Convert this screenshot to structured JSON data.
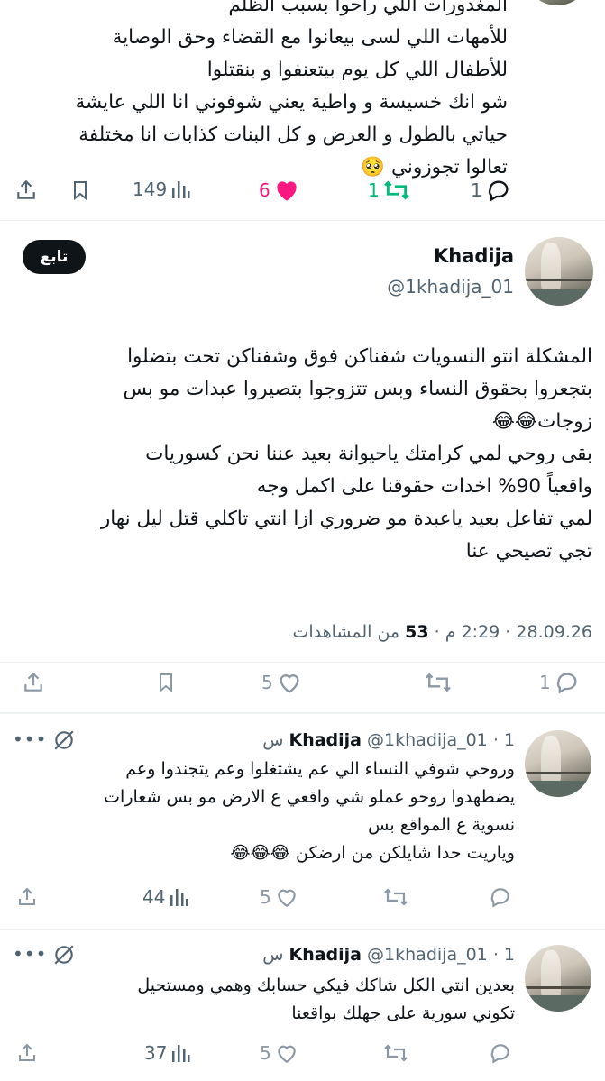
{
  "top_tweet": {
    "lines": [
      "المغدورات اللي راحوا بسبب الظلم",
      "للأمهات اللي لسى بيعانوا مع القضاء وحق الوصاية",
      "للأطفال اللي كل يوم بيتعنفوا و بنقتلوا",
      "شو انك خسيسة و واطية يعني شوفوني انا اللي عايشة",
      "حياتي بالطول و العرض و كل البنات كذابات انا مختلفة",
      "تعالوا تجوزوني 🥺"
    ],
    "views": "149",
    "likes": "6",
    "retweets": "1",
    "replies": "1"
  },
  "main_tweet": {
    "author_name": "Khadija",
    "author_handle": "@1khadija_01",
    "follow_label": "تابع",
    "lines": [
      "المشكلة انتو النسويات شفناكن فوق وشفناكن تحت بتضلوا",
      "بتجعروا بحقوق النساء وبس تتزوجوا بتصيروا عبدات مو بس",
      "زوجات😂😂",
      "بقى روحي لمي كرامتك ياحيوانة بعيد عننا نحن كسوريات",
      "واقعياً 90% اخدات حقوقنا على اكمل وجه",
      "لمي تفاعل بعيد ياعبدة مو ضروري ازا انتي تاكلي قتل ليل نهار",
      "تجي تصيحي عنا"
    ],
    "meta": "28.09.26 · 2:29 م · 53 من المشاهدات",
    "meta_date": "28.09.26",
    "meta_time": "2:29 م",
    "meta_views_count": "53",
    "meta_views_label": "من المشاهدات",
    "likes": "5",
    "replies": "1"
  },
  "replies": [
    {
      "author_name": "Khadija",
      "author_handle": "@1khadija_01",
      "time": "1 س",
      "lines": [
        "وروحي شوفي النساء الي عم يشتغلوا وعم يتجندوا وعم",
        "يضطهدوا روحو عملو شي واقعي ع الارض مو بس شعارات",
        "نسوية ع المواقع بس",
        "وياريت حدا شايلكن من ارضكن 😂😂😂"
      ],
      "views": "44",
      "likes": "5"
    },
    {
      "author_name": "Khadija",
      "author_handle": "@1khadija_01",
      "time": "1 س",
      "lines": [
        "بعدين انتي الكل شاكك فيكي حسابك وهمي ومستحيل",
        "تكوني سورية على جهلك بواقعنا"
      ],
      "views": "37",
      "likes": "5"
    }
  ],
  "colors": {
    "like_active": "#f91880",
    "retweet_active": "#00ba7c",
    "text": "#0f1419",
    "muted": "#536471",
    "follow_bg": "#0f1419"
  }
}
